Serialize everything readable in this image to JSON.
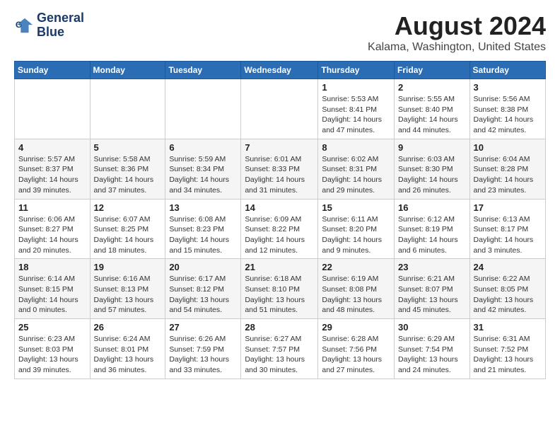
{
  "header": {
    "logo_line1": "General",
    "logo_line2": "Blue",
    "month_title": "August 2024",
    "location": "Kalama, Washington, United States"
  },
  "days_of_week": [
    "Sunday",
    "Monday",
    "Tuesday",
    "Wednesday",
    "Thursday",
    "Friday",
    "Saturday"
  ],
  "weeks": [
    [
      {
        "day": "",
        "info": ""
      },
      {
        "day": "",
        "info": ""
      },
      {
        "day": "",
        "info": ""
      },
      {
        "day": "",
        "info": ""
      },
      {
        "day": "1",
        "info": "Sunrise: 5:53 AM\nSunset: 8:41 PM\nDaylight: 14 hours and 47 minutes."
      },
      {
        "day": "2",
        "info": "Sunrise: 5:55 AM\nSunset: 8:40 PM\nDaylight: 14 hours and 44 minutes."
      },
      {
        "day": "3",
        "info": "Sunrise: 5:56 AM\nSunset: 8:38 PM\nDaylight: 14 hours and 42 minutes."
      }
    ],
    [
      {
        "day": "4",
        "info": "Sunrise: 5:57 AM\nSunset: 8:37 PM\nDaylight: 14 hours and 39 minutes."
      },
      {
        "day": "5",
        "info": "Sunrise: 5:58 AM\nSunset: 8:36 PM\nDaylight: 14 hours and 37 minutes."
      },
      {
        "day": "6",
        "info": "Sunrise: 5:59 AM\nSunset: 8:34 PM\nDaylight: 14 hours and 34 minutes."
      },
      {
        "day": "7",
        "info": "Sunrise: 6:01 AM\nSunset: 8:33 PM\nDaylight: 14 hours and 31 minutes."
      },
      {
        "day": "8",
        "info": "Sunrise: 6:02 AM\nSunset: 8:31 PM\nDaylight: 14 hours and 29 minutes."
      },
      {
        "day": "9",
        "info": "Sunrise: 6:03 AM\nSunset: 8:30 PM\nDaylight: 14 hours and 26 minutes."
      },
      {
        "day": "10",
        "info": "Sunrise: 6:04 AM\nSunset: 8:28 PM\nDaylight: 14 hours and 23 minutes."
      }
    ],
    [
      {
        "day": "11",
        "info": "Sunrise: 6:06 AM\nSunset: 8:27 PM\nDaylight: 14 hours and 20 minutes."
      },
      {
        "day": "12",
        "info": "Sunrise: 6:07 AM\nSunset: 8:25 PM\nDaylight: 14 hours and 18 minutes."
      },
      {
        "day": "13",
        "info": "Sunrise: 6:08 AM\nSunset: 8:23 PM\nDaylight: 14 hours and 15 minutes."
      },
      {
        "day": "14",
        "info": "Sunrise: 6:09 AM\nSunset: 8:22 PM\nDaylight: 14 hours and 12 minutes."
      },
      {
        "day": "15",
        "info": "Sunrise: 6:11 AM\nSunset: 8:20 PM\nDaylight: 14 hours and 9 minutes."
      },
      {
        "day": "16",
        "info": "Sunrise: 6:12 AM\nSunset: 8:19 PM\nDaylight: 14 hours and 6 minutes."
      },
      {
        "day": "17",
        "info": "Sunrise: 6:13 AM\nSunset: 8:17 PM\nDaylight: 14 hours and 3 minutes."
      }
    ],
    [
      {
        "day": "18",
        "info": "Sunrise: 6:14 AM\nSunset: 8:15 PM\nDaylight: 14 hours and 0 minutes."
      },
      {
        "day": "19",
        "info": "Sunrise: 6:16 AM\nSunset: 8:13 PM\nDaylight: 13 hours and 57 minutes."
      },
      {
        "day": "20",
        "info": "Sunrise: 6:17 AM\nSunset: 8:12 PM\nDaylight: 13 hours and 54 minutes."
      },
      {
        "day": "21",
        "info": "Sunrise: 6:18 AM\nSunset: 8:10 PM\nDaylight: 13 hours and 51 minutes."
      },
      {
        "day": "22",
        "info": "Sunrise: 6:19 AM\nSunset: 8:08 PM\nDaylight: 13 hours and 48 minutes."
      },
      {
        "day": "23",
        "info": "Sunrise: 6:21 AM\nSunset: 8:07 PM\nDaylight: 13 hours and 45 minutes."
      },
      {
        "day": "24",
        "info": "Sunrise: 6:22 AM\nSunset: 8:05 PM\nDaylight: 13 hours and 42 minutes."
      }
    ],
    [
      {
        "day": "25",
        "info": "Sunrise: 6:23 AM\nSunset: 8:03 PM\nDaylight: 13 hours and 39 minutes."
      },
      {
        "day": "26",
        "info": "Sunrise: 6:24 AM\nSunset: 8:01 PM\nDaylight: 13 hours and 36 minutes."
      },
      {
        "day": "27",
        "info": "Sunrise: 6:26 AM\nSunset: 7:59 PM\nDaylight: 13 hours and 33 minutes."
      },
      {
        "day": "28",
        "info": "Sunrise: 6:27 AM\nSunset: 7:57 PM\nDaylight: 13 hours and 30 minutes."
      },
      {
        "day": "29",
        "info": "Sunrise: 6:28 AM\nSunset: 7:56 PM\nDaylight: 13 hours and 27 minutes."
      },
      {
        "day": "30",
        "info": "Sunrise: 6:29 AM\nSunset: 7:54 PM\nDaylight: 13 hours and 24 minutes."
      },
      {
        "day": "31",
        "info": "Sunrise: 6:31 AM\nSunset: 7:52 PM\nDaylight: 13 hours and 21 minutes."
      }
    ]
  ]
}
